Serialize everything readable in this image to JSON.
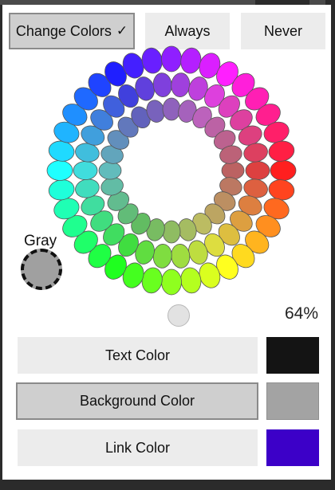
{
  "toolbar": {
    "change_colors_label": "Change Colors",
    "change_colors_checked": true,
    "always_label": "Always",
    "never_label": "Never"
  },
  "gray": {
    "label": "Gray",
    "color": "#a0a0a0"
  },
  "lightness": {
    "percent_text": "64%",
    "value": 0.64
  },
  "colors": {
    "text_label": "Text Color",
    "text_swatch": "#141414",
    "background_label": "Background Color",
    "background_swatch": "#a3a3a3",
    "link_label": "Link Color",
    "link_swatch": "#3c00c8"
  },
  "icons": {
    "checkmark": "check-icon"
  }
}
